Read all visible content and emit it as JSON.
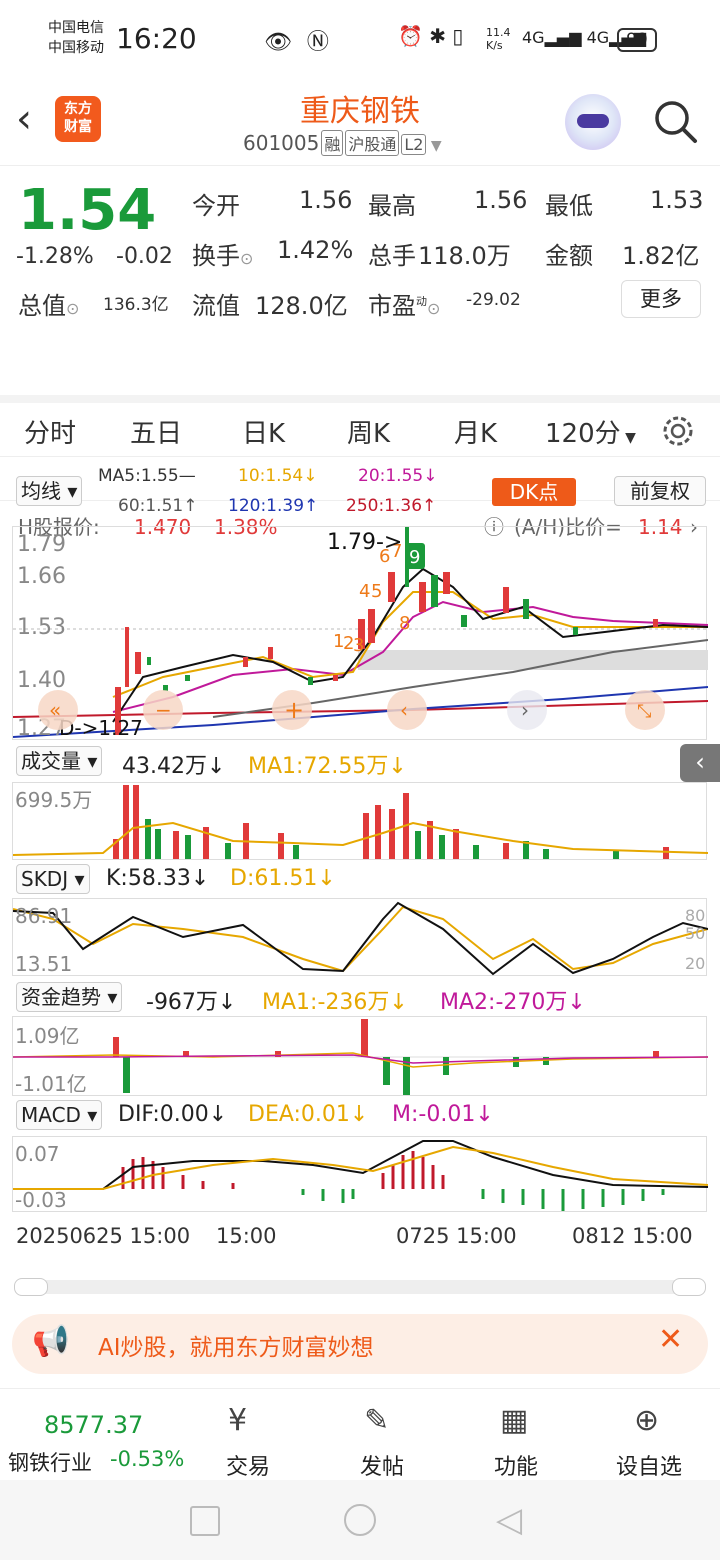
{
  "status": {
    "carrier1": "中国电信",
    "carrier2": "中国移动",
    "time": "16:20",
    "speed": "11.4",
    "speed_unit": "K/s",
    "battery": "99"
  },
  "header": {
    "logo": "东方\n财富",
    "title": "重庆钢铁",
    "code": "601005",
    "tags": [
      "融",
      "沪股通",
      "L2"
    ]
  },
  "quote": {
    "price": "1.54",
    "change_pct": "-1.28%",
    "change": "-0.02",
    "open_label": "今开",
    "open": "1.56",
    "high_label": "最高",
    "high": "1.56",
    "low_label": "最低",
    "low": "1.53",
    "turnover_label": "换手",
    "turnover": "1.42%",
    "volume_label": "总手",
    "volume": "118.0万",
    "amount_label": "金额",
    "amount": "1.82亿",
    "mcap_label": "总值",
    "mcap": "136.3亿",
    "float_label": "流值",
    "float": "128.0亿",
    "pe_label": "市盈",
    "pe_sup": "动",
    "pe": "-29.02",
    "more": "更多"
  },
  "hshare": {
    "label": "H股报价:",
    "price": "1.470",
    "pct": "1.38%",
    "ah_label": "(A/H)比价=",
    "ah": "1.14"
  },
  "tabs": [
    "分时",
    "五日",
    "日K",
    "周K",
    "月K",
    "120分"
  ],
  "ma": {
    "select": "均线",
    "ma5": "MA5:1.55—",
    "ma10": "10:1.54↓",
    "ma20": "20:1.55↓",
    "ma60": "60:1.51↑",
    "ma120": "120:1.39↑",
    "ma250": "250:1.36↑",
    "dk": "DK点",
    "fq": "前复权"
  },
  "kline": {
    "y1": "1.79",
    "y2": "1.66",
    "y3": "1.53",
    "y4": "1.40",
    "y5": "1.27",
    "hi_note": "1.79->",
    "lo_note": "D->1.27",
    "marks": [
      "1",
      "2",
      "3",
      "4",
      "5",
      "6",
      "7",
      "8",
      "9"
    ]
  },
  "vol": {
    "select": "成交量",
    "value": "43.42万↓",
    "ma1": "MA1:72.55万↓",
    "ymax": "699.5万"
  },
  "skdj": {
    "select": "SKDJ",
    "k": "K:58.33↓",
    "d": "D:61.51↓",
    "y1": "86.91",
    "y2": "13.51",
    "r80": "80",
    "r50": "50",
    "r20": "20"
  },
  "fund": {
    "select": "资金趋势",
    "value": "-967万↓",
    "ma1": "MA1:-236万↓",
    "ma2": "MA2:-270万↓",
    "y1": "1.09亿",
    "y2": "-1.01亿"
  },
  "macd": {
    "select": "MACD",
    "dif": "DIF:0.00↓",
    "dea": "DEA:0.01↓",
    "m": "M:-0.01↓",
    "y1": "0.07",
    "y2": "-0.03"
  },
  "xaxis": {
    "a": "20250625 15:00",
    "b": "15:00",
    "c": "0725 15:00",
    "d": "0812 15:00"
  },
  "banner": {
    "text": "AI炒股，就用东方财富妙想"
  },
  "bottom": {
    "index": "8577.37",
    "industry": "钢铁行业",
    "industry_pct": "-0.53%",
    "trade": "交易",
    "post": "发帖",
    "func": "功能",
    "fav": "设自选"
  }
}
